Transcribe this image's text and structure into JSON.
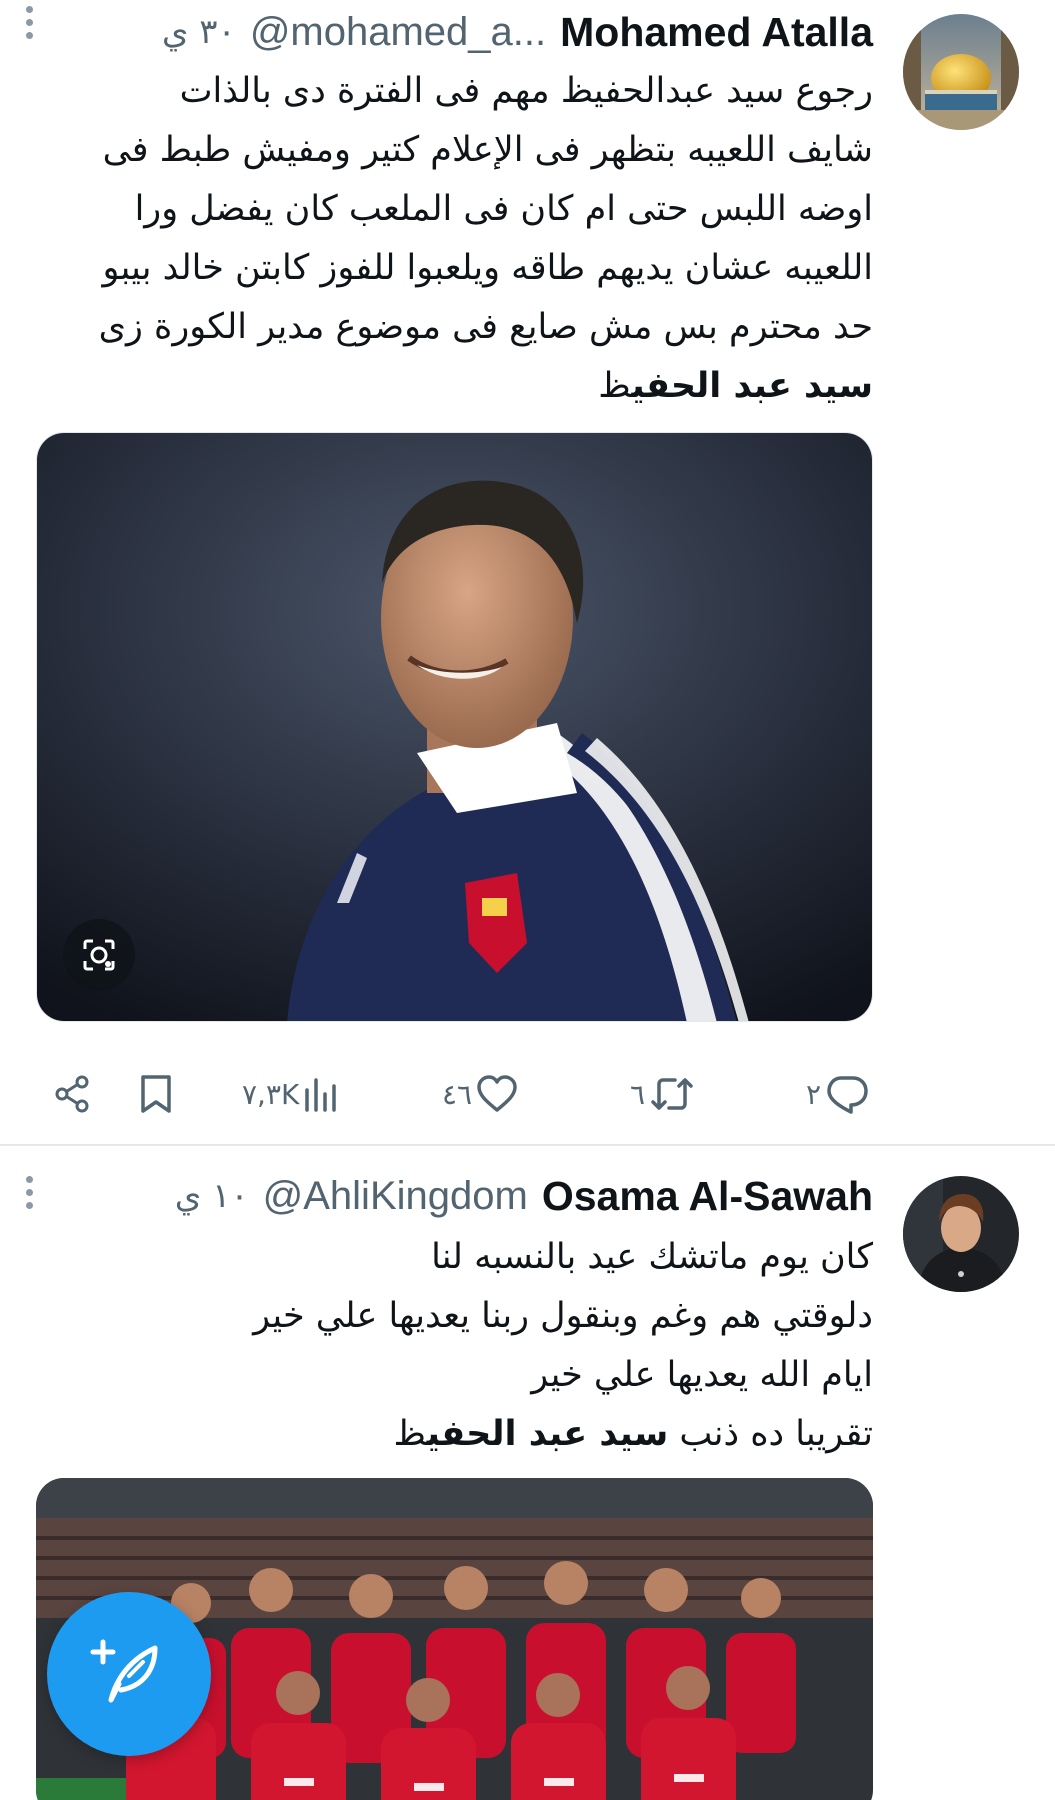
{
  "tweets": [
    {
      "display_name": "Mohamed Atalla",
      "handle": "@mohamed_a...",
      "time": "٣٠ ي",
      "lines": [
        "رجوع سيد عبدالحفيظ مهم فى الفترة دى بالذات",
        "شايف اللعيبه بتظهر فى الإعلام كتير ومفيش طبط فى",
        "اوضه اللبس حتى ام كان فى الملعب كان يفضل ورا",
        "اللعيبه عشان يديهم طاقه ويلعبوا للفوز كابتن خالد بيبو",
        "حد محترم بس مش صايع فى موضوع مدير الكورة زى"
      ],
      "last_line_bold": "سيد عبد الحفي",
      "last_line_rest": "ظ",
      "actions": {
        "replies": "٢",
        "reposts": "٦",
        "likes": "٤٦",
        "views": "٧,٣K"
      }
    },
    {
      "display_name": "Osama Al-Sawah",
      "handle": "@AhliKingdom",
      "time": "١٠ ي",
      "lines": [
        "كان يوم ماتشك عيد بالنسبه لنا",
        "دلوقتي هم وغم وبنقول ربنا يعديها علي خير",
        "ايام الله يعديها علي خير"
      ],
      "last_line_prefix": "تقريبا ده ذنب ",
      "last_line_bold": "سيد عبد الحفي",
      "last_line_rest": "ظ"
    }
  ],
  "icons": {
    "more": "more-vertical-icon",
    "reply": "reply-icon",
    "repost": "repost-icon",
    "like": "like-icon",
    "views": "views-icon",
    "bookmark": "bookmark-icon",
    "share": "share-icon",
    "lens": "image-search-icon",
    "compose": "compose-post-icon"
  },
  "colors": {
    "accent": "#1d9bf0",
    "secondary_text": "#536471",
    "divider": "#e4e8eb"
  }
}
